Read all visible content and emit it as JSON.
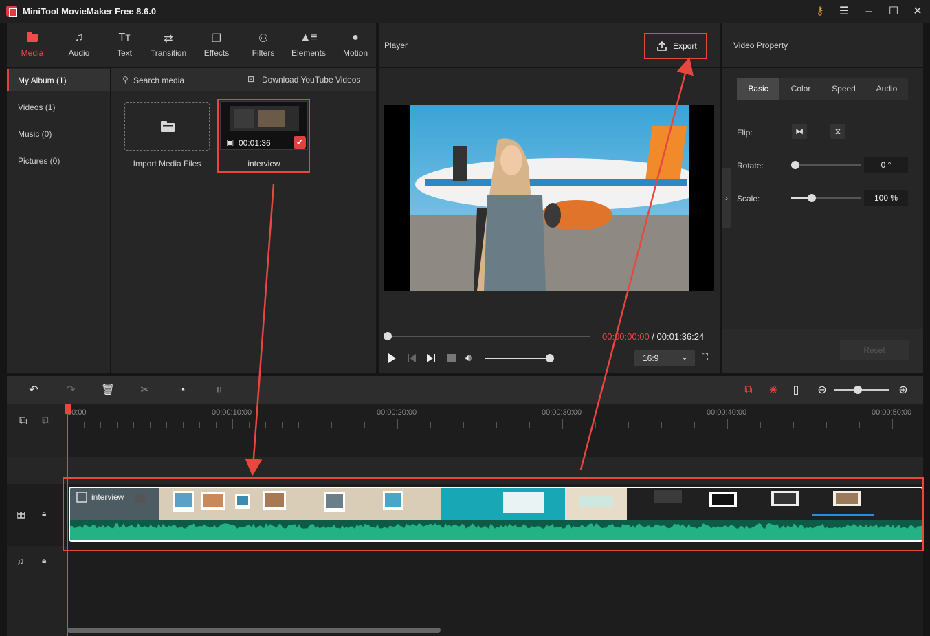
{
  "app": {
    "title": "MiniTool MovieMaker Free 8.6.0"
  },
  "window_controls": [
    "key-icon",
    "menu-icon",
    "minimize-icon",
    "maximize-icon",
    "close-icon"
  ],
  "toolbar": {
    "tabs": [
      {
        "label": "Media",
        "icon": "media-icon",
        "active": true
      },
      {
        "label": "Audio",
        "icon": "music-note-icon"
      },
      {
        "label": "Text",
        "icon": "text-icon"
      },
      {
        "label": "Transition",
        "icon": "transition-icon"
      },
      {
        "label": "Effects",
        "icon": "effects-icon"
      },
      {
        "label": "Filters",
        "icon": "filters-icon"
      },
      {
        "label": "Elements",
        "icon": "elements-icon"
      },
      {
        "label": "Motion",
        "icon": "motion-icon"
      }
    ]
  },
  "album": {
    "items": [
      {
        "label": "My Album (1)",
        "active": true
      },
      {
        "label": "Videos (1)"
      },
      {
        "label": "Music (0)"
      },
      {
        "label": "Pictures (0)"
      }
    ]
  },
  "media": {
    "search_placeholder": "Search media",
    "download_label": "Download YouTube Videos",
    "import_label": "Import Media Files",
    "clip": {
      "name": "interview",
      "duration": "00:01:36"
    }
  },
  "player": {
    "title": "Player",
    "export_label": "Export",
    "current_time": "00:00:00:00",
    "separator": " / ",
    "total_time": "00:01:36:24",
    "aspect_ratio": "16:9"
  },
  "property": {
    "title": "Video Property",
    "tabs": [
      "Basic",
      "Color",
      "Speed",
      "Audio"
    ],
    "flip_label": "Flip:",
    "rotate_label": "Rotate:",
    "rotate_value": "0 °",
    "scale_label": "Scale:",
    "scale_value": "100 %",
    "reset_label": "Reset"
  },
  "timeline": {
    "ruler": [
      "00:00",
      "00:00:10:00",
      "00:00:20:00",
      "00:00:30:00",
      "00:00:40:00",
      "00:00:50:00"
    ],
    "clip_name": "interview"
  },
  "colors": {
    "accent": "#e8463f",
    "waveform": "#1fa37a",
    "panel": "#262626"
  }
}
